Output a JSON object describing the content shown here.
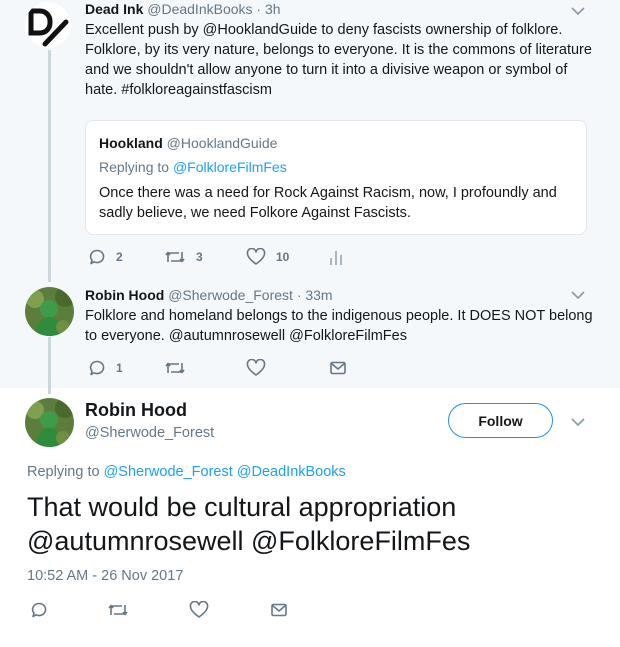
{
  "colors": {
    "link": "#1da1f2",
    "muted": "#657786",
    "text": "#14171a",
    "thread_bg": "#f5f8fa",
    "border": "#e1e8ed"
  },
  "tweet1": {
    "avatar_text": "D/",
    "name": "Dead Ink",
    "handle": "@DeadInkBooks",
    "time": "· 3h",
    "text_lines": [
      "Excellent push by @HooklandGuide to deny fascists ownership of folklore.",
      "Folklore, by its very nature, belongs to everyone. It is the commons of literature",
      "and we shouldn't allow anyone to turn it into a divisive weapon or symbol of",
      "hate. #folkloreagainstfascism"
    ],
    "quote": {
      "name": "Hookland",
      "handle": "@HooklandGuide",
      "replying_prefix": "Replying to",
      "replying_to": "@FolkloreFilmFes",
      "text_lines": [
        "Once there was a need for Rock Against Racism, now, I profoundly and",
        "sadly believe, we need Folkore Against Fascists."
      ]
    },
    "actions": {
      "replies": "2",
      "retweets": "3",
      "likes": "10"
    }
  },
  "tweet2": {
    "name": "Robin Hood",
    "handle": "@Sherwode_Forest",
    "time": "· 33m",
    "text_lines": [
      "Folklore and homeland belongs to the indigenous people. It DOES NOT belong",
      "to everyone. @autumnrosewell  @FolkloreFilmFes"
    ],
    "actions": {
      "replies": "1"
    }
  },
  "main": {
    "name": "Robin Hood",
    "handle": "@Sherwode_Forest",
    "follow_label": "Follow",
    "replying_prefix": "Replying to",
    "replying_to": "@Sherwode_Forest @DeadInkBooks",
    "text_lines": [
      "That would be cultural appropriation",
      "@autumnrosewell @FolkloreFilmFes"
    ],
    "timestamp": "10:52 AM - 26 Nov 2017"
  }
}
